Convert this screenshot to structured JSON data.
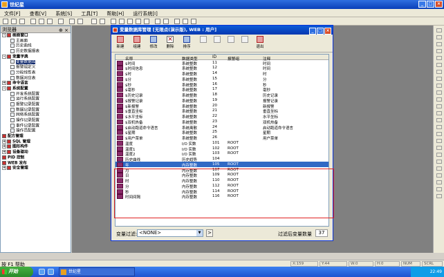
{
  "app": {
    "title": "世纪星"
  },
  "menu": [
    "文件[F]",
    "查看[V]",
    "系统[S]",
    "工具[T]",
    "帮助[H]",
    "运行系统[I]"
  ],
  "sidebar": {
    "title": "浏览器",
    "items": [
      {
        "label": "画面窗口",
        "level": 0,
        "bold": true,
        "expander": "-"
      },
      {
        "label": "主画面",
        "level": 1
      },
      {
        "label": "历史曲线",
        "level": 1
      },
      {
        "label": "历史数据报表",
        "level": 1
      },
      {
        "label": "变量字典",
        "level": 0,
        "bold": true,
        "expander": "-"
      },
      {
        "label": "变量数据库",
        "level": 1,
        "selected": true
      },
      {
        "label": "报警组定义",
        "level": 1
      },
      {
        "label": "分段线性表",
        "level": 1
      },
      {
        "label": "数据对应表",
        "level": 1
      },
      {
        "label": "命令语言",
        "level": 0,
        "bold": true,
        "expander": "+"
      },
      {
        "label": "系统配置",
        "level": 0,
        "bold": true,
        "expander": "-"
      },
      {
        "label": "开发系统配置",
        "level": 1
      },
      {
        "label": "运行系统配置",
        "level": 1
      },
      {
        "label": "报警记录配置",
        "level": 1
      },
      {
        "label": "数据记录配置",
        "level": 1
      },
      {
        "label": "网络系统配置",
        "level": 1
      },
      {
        "label": "操作记录配置",
        "level": 1
      },
      {
        "label": "事件记录配置",
        "level": 1
      },
      {
        "label": "操作员配置",
        "level": 1
      },
      {
        "label": "配方管理",
        "level": 0,
        "bold": true
      },
      {
        "label": "SQL 管理",
        "level": 0,
        "bold": true,
        "expander": "+"
      },
      {
        "label": "图形构件",
        "level": 0,
        "bold": true,
        "expander": "+"
      },
      {
        "label": "设备驱动",
        "level": 0,
        "bold": true,
        "expander": "+"
      },
      {
        "label": "PID 控制",
        "level": 0,
        "bold": true
      },
      {
        "label": "WEB 发布",
        "level": 0,
        "bold": true
      },
      {
        "label": "安全管理",
        "level": 0,
        "bold": true,
        "expander": "+"
      }
    ]
  },
  "dialog": {
    "title": "变量数据库管理 [无限点(演示版), WEB : 用户]",
    "toolbar": [
      "新建",
      "组建",
      "修改",
      "删除",
      "排序",
      "",
      "",
      "",
      "",
      "退出"
    ],
    "columns": [
      "名称",
      "数据类型",
      "ID",
      "报警组",
      "注释"
    ],
    "rows": [
      [
        "$时间",
        "系统整数",
        "11",
        "",
        "时间"
      ],
      [
        "$时间信息",
        "系统整数",
        "12",
        "",
        "时间"
      ],
      [
        "$时",
        "系统整数",
        "14",
        "",
        "时"
      ],
      [
        "$分",
        "系统整数",
        "15",
        "",
        "分"
      ],
      [
        "$秒",
        "系统整数",
        "16",
        "",
        "秒"
      ],
      [
        "$毫秒",
        "系统整数",
        "17",
        "",
        "毫秒"
      ],
      [
        "$历史记录",
        "系统整数",
        "18",
        "",
        "历史记录"
      ],
      [
        "$报警记录",
        "系统整数",
        "19",
        "",
        "报警记录"
      ],
      [
        "$新报警",
        "系统整数",
        "20",
        "",
        "新报警"
      ],
      [
        "$垂直坐标",
        "系统整数",
        "21",
        "",
        "垂直坐标"
      ],
      [
        "$水平坐标",
        "系统整数",
        "22",
        "",
        "水平坐标"
      ],
      [
        "$双机热备",
        "系统整数",
        "23",
        "",
        "双机热备"
      ],
      [
        "$启动跑道命令语言",
        "系统离散",
        "24",
        "",
        "启动跑道命令语言"
      ],
      [
        "$星期",
        "系统整数",
        "25",
        "",
        "星期"
      ],
      [
        "$用户菜单",
        "系统整数",
        "26",
        "",
        "用户菜单"
      ],
      [
        "温度",
        "I/O 实数",
        "101",
        "ROOT",
        ""
      ],
      [
        "温度1",
        "I/O 实数",
        "102",
        "ROOT",
        ""
      ],
      [
        "温度2",
        "I/O 实数",
        "103",
        "ROOT",
        ""
      ],
      [
        "历史曲线",
        "历史趋势",
        "104",
        "",
        ""
      ],
      [
        "年",
        "内存整数",
        "105",
        "ROOT",
        ""
      ],
      [
        "月",
        "内存整数",
        "107",
        "ROOT",
        ""
      ],
      [
        "日",
        "内存整数",
        "109",
        "ROOT",
        ""
      ],
      [
        "时",
        "内存整数",
        "110",
        "ROOT",
        ""
      ],
      [
        "分",
        "内存整数",
        "112",
        "ROOT",
        ""
      ],
      [
        "秒",
        "内存整数",
        "114",
        "ROOT",
        ""
      ],
      [
        "时间间隔",
        "内存整数",
        "116",
        "ROOT",
        ""
      ]
    ],
    "selected_row": 19,
    "filter_label": "变量过滤:",
    "filter_value": "<NONE>",
    "filter_go": ">",
    "count_label": "过滤后变量数量",
    "count_value": "37"
  },
  "status": {
    "text": "按 F1 帮助",
    "cells": [
      "X:159",
      "Y:44",
      "W:0",
      "H:0",
      "NUM",
      "SCRL"
    ]
  },
  "taskbar": {
    "start": "开始",
    "task": "世纪星",
    "clock": "22:49"
  }
}
